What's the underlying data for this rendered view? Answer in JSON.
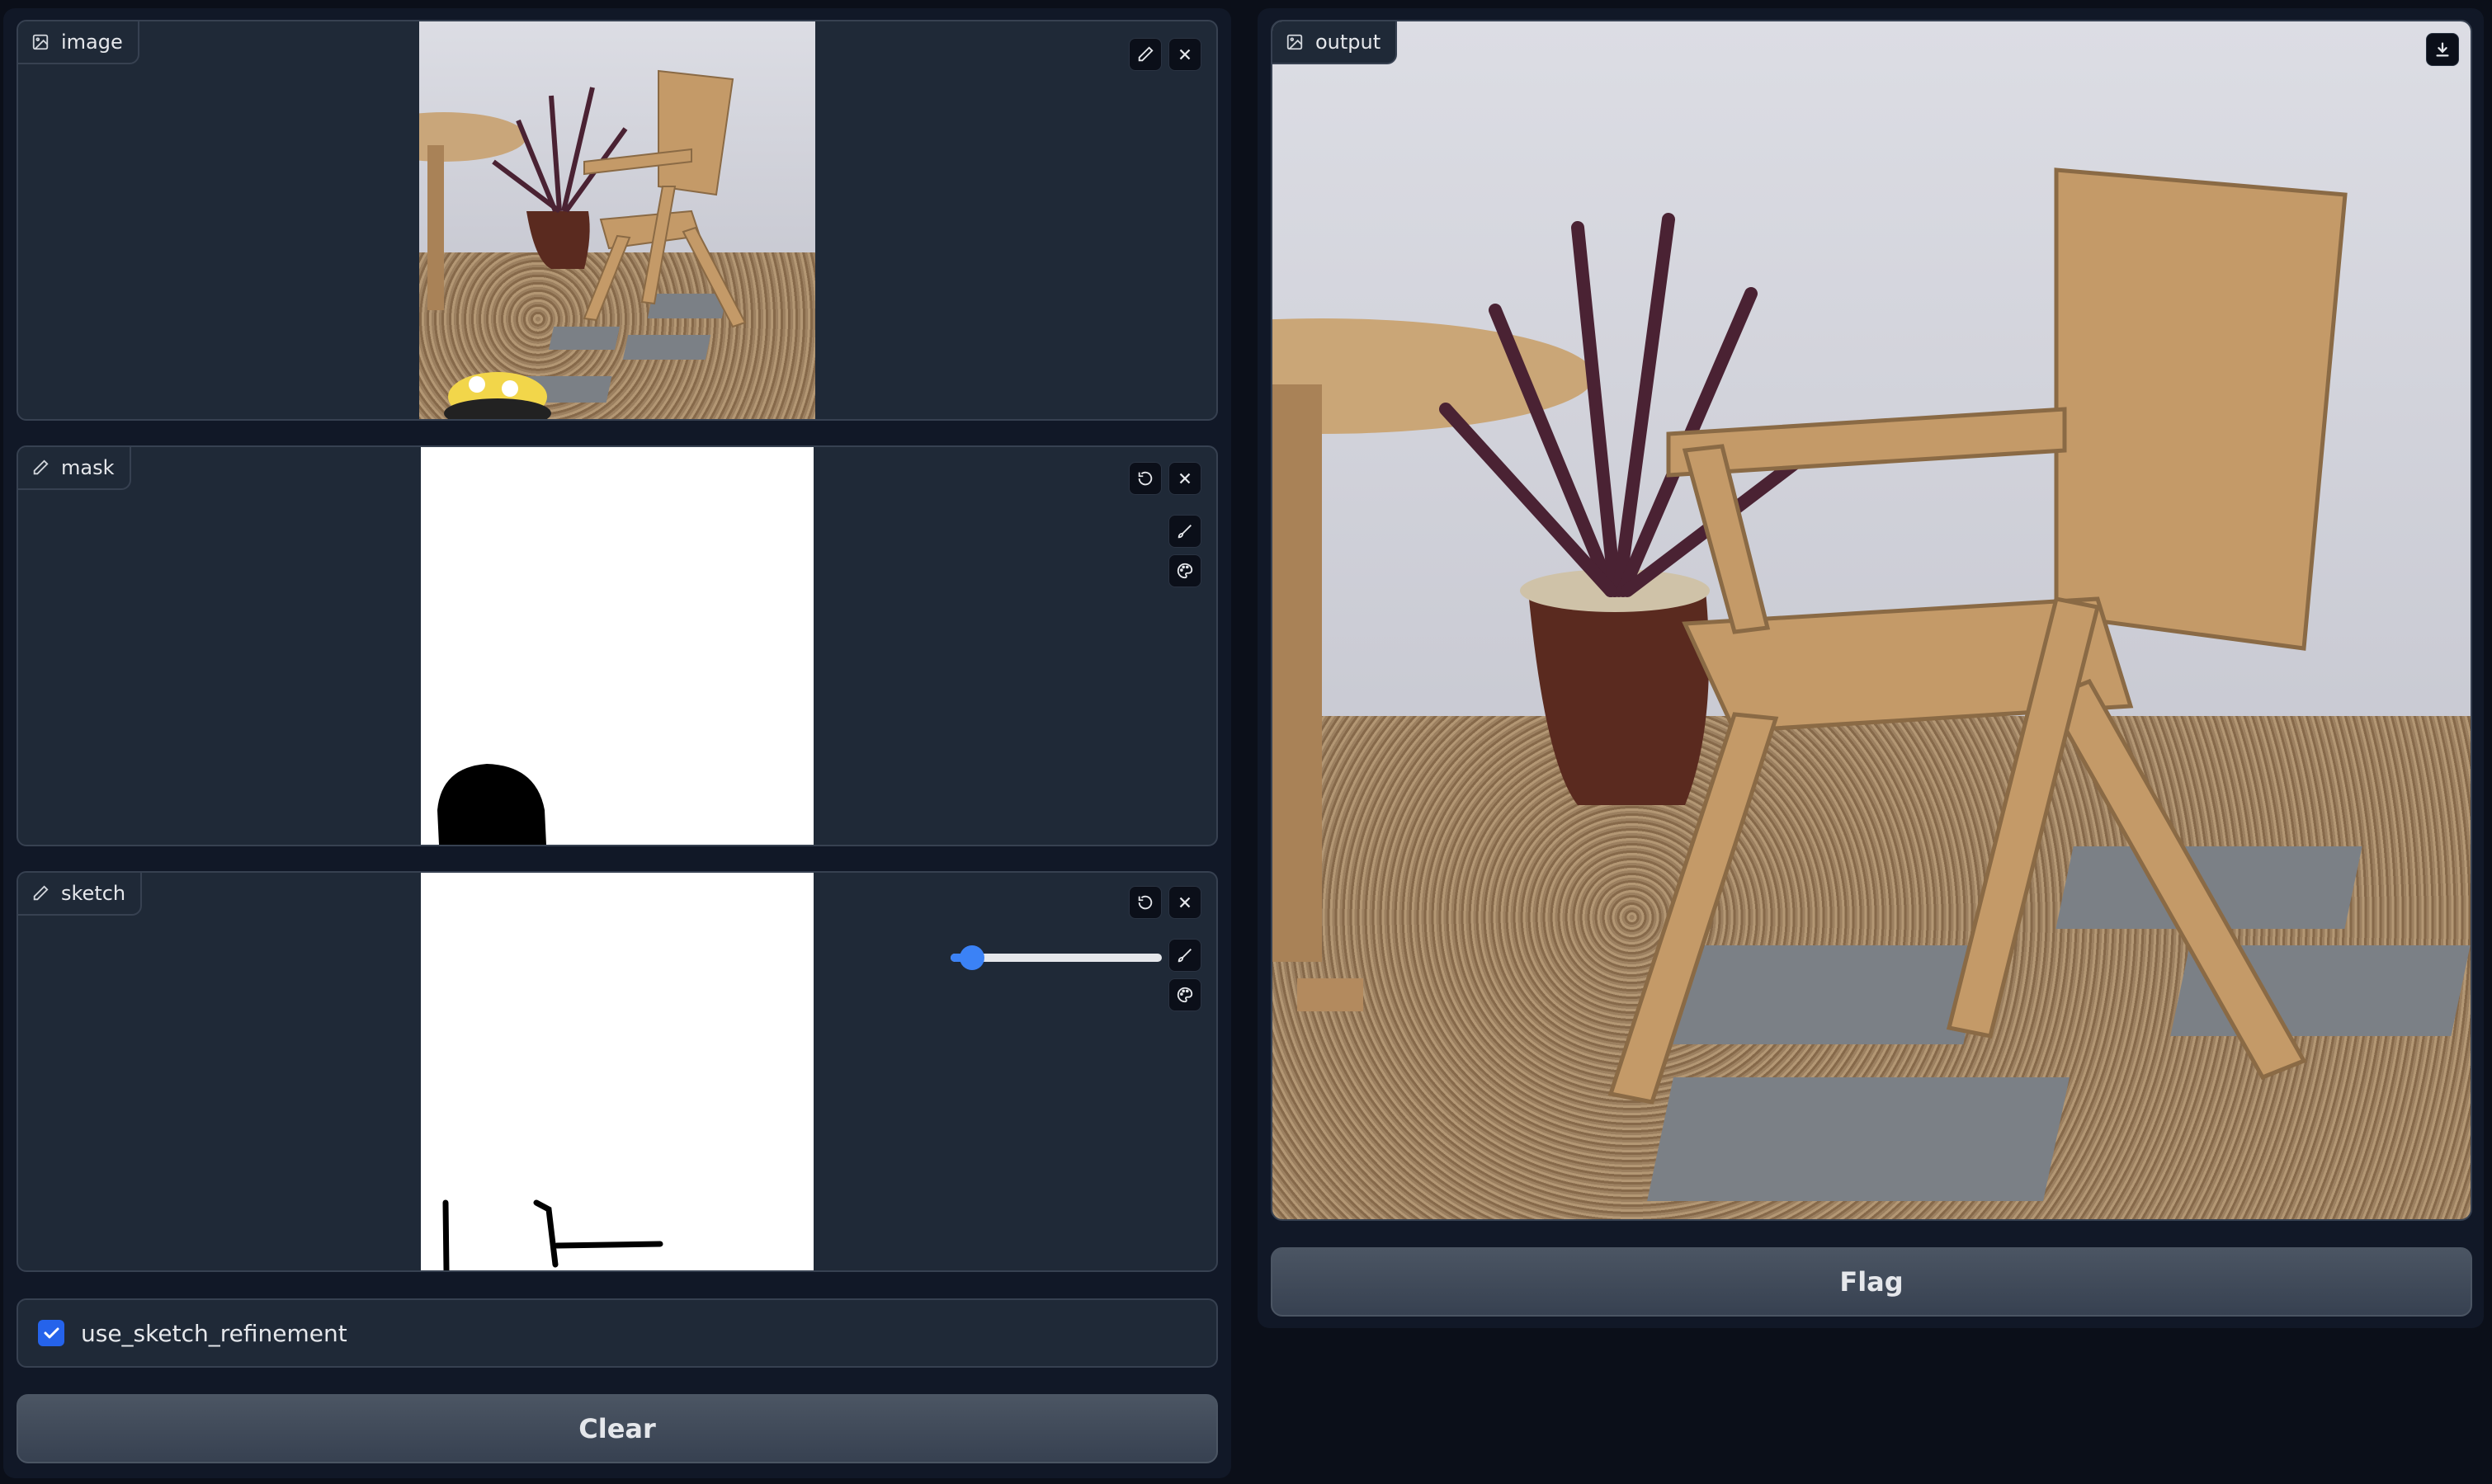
{
  "inputs": {
    "image": {
      "label": "image",
      "icon": "image-icon"
    },
    "mask": {
      "label": "mask",
      "icon": "pencil-icon"
    },
    "sketch": {
      "label": "sketch",
      "icon": "pencil-icon",
      "brush_size_fraction": 0.05
    }
  },
  "options": {
    "use_sketch_refinement": {
      "label": "use_sketch_refinement",
      "checked": true
    }
  },
  "buttons": {
    "clear_label": "Clear",
    "flag_label": "Flag"
  },
  "output": {
    "label": "output",
    "icon": "image-icon"
  },
  "colors": {
    "background": "#0b0f19",
    "panel": "#1f2937",
    "border": "#374151",
    "accent": "#2563eb",
    "slider": "#3b82f6"
  }
}
